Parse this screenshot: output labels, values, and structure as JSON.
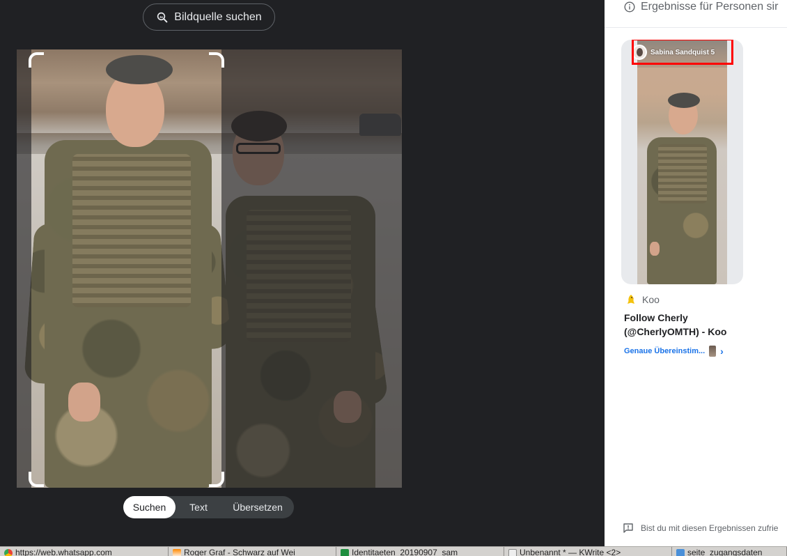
{
  "left_pane": {
    "source_button": {
      "label": "Bildquelle suchen",
      "icon": "image-search-icon"
    },
    "modes": [
      {
        "label": "Suchen",
        "active": true
      },
      {
        "label": "Text",
        "active": false
      },
      {
        "label": "Übersetzen",
        "active": false
      }
    ]
  },
  "right_pane": {
    "header": {
      "text": "Ergebnisse für Personen sir",
      "icon": "info-icon"
    },
    "result": {
      "story_name": "Sabina Sandquist 5",
      "source": "Koo",
      "source_icon": "koo-bird-icon",
      "title": "Follow Cherly (@CherlyOMTH) - Koo",
      "match_label": "Genaue Übereinstim...",
      "match_chevron": "›",
      "highlight_color": "#ff0000"
    },
    "feedback": {
      "text": "Bist du mit diesen Ergebnissen zufrie",
      "icon": "feedback-icon"
    }
  },
  "taskbar": {
    "items": [
      {
        "label": "https://web.whatsapp.com",
        "icon": "chrome-icon"
      },
      {
        "label": "Roger Graf - Schwarz auf Wei",
        "icon": "vlc-icon"
      },
      {
        "label": "Identitaeten_20190907_sam",
        "icon": "spreadsheet-icon"
      },
      {
        "label": "Unbenannt * — KWrite <2>",
        "icon": "kwrite-icon"
      },
      {
        "label": "seite_zugangsdaten",
        "icon": "file-manager-icon"
      }
    ]
  },
  "colors": {
    "accent": "#1a73e8",
    "dark_bg": "#202124",
    "highlight": "#ff0000"
  }
}
